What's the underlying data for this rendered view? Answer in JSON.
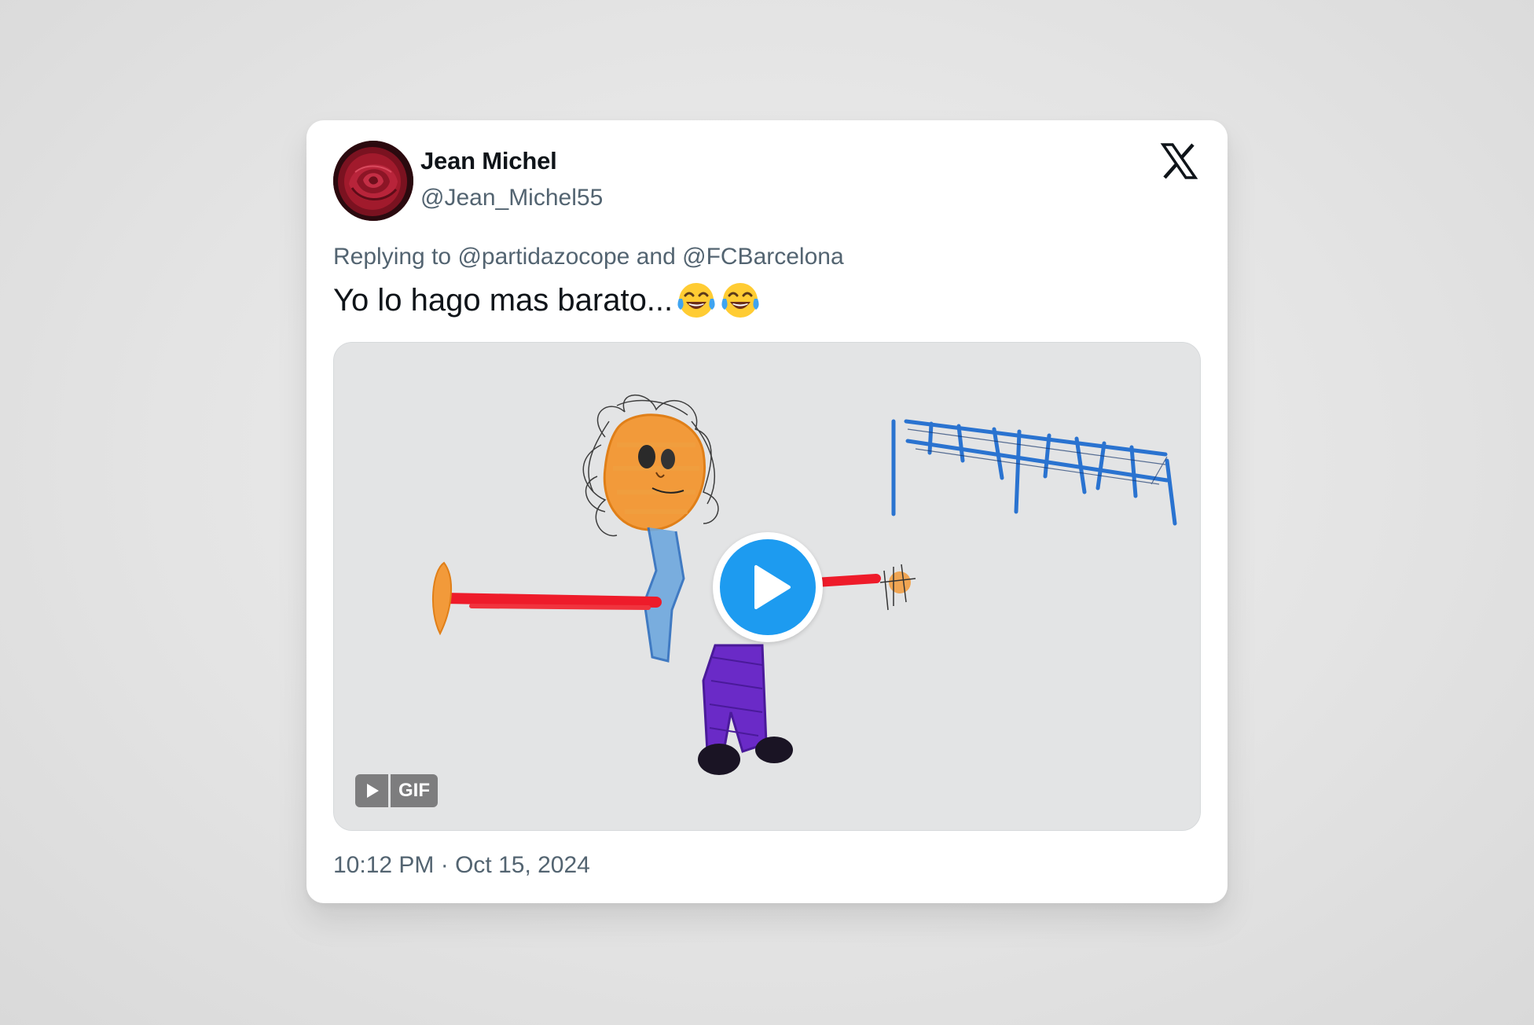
{
  "tweet": {
    "author": {
      "display_name": "Jean Michel",
      "handle": "@Jean_Michel55",
      "avatar_icon": "rose-avatar"
    },
    "reply": {
      "prefix": "Replying to",
      "mention_1": "@partidazocope",
      "conjunction": "and",
      "mention_2": "@FCBarcelona"
    },
    "text": "Yo lo hago mas barato...",
    "emojis": [
      "face-with-tears-of-joy",
      "face-with-tears-of-joy"
    ],
    "media": {
      "type": "GIF",
      "badge_label": "GIF",
      "play_icon": "play-icon",
      "content": "child-crayon-drawing"
    },
    "timestamp": "10:12 PM · Oct 15, 2024"
  },
  "brand": {
    "logo_icon": "x-logo-icon"
  },
  "colors": {
    "card_background": "#ffffff",
    "primary_text": "#0f1419",
    "secondary_text": "#536471",
    "play_button": "#1d9bf0"
  }
}
